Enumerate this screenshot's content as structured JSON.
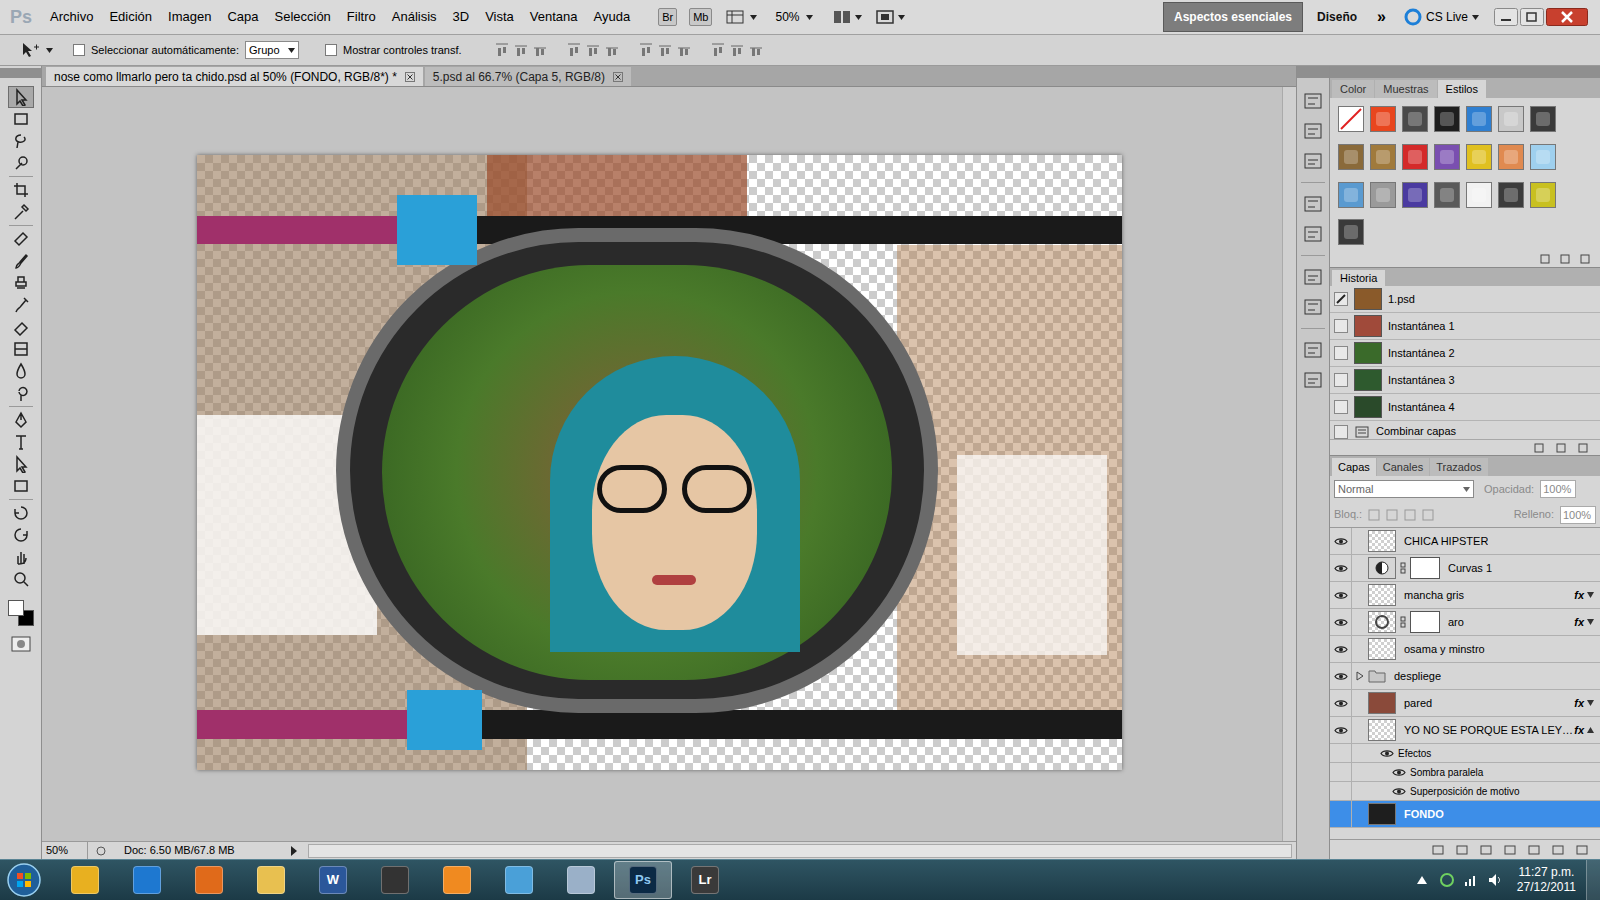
{
  "app": {
    "logo": "Ps",
    "menu": [
      "Archivo",
      "Edición",
      "Imagen",
      "Capa",
      "Selección",
      "Filtro",
      "Análisis",
      "3D",
      "Vista",
      "Ventana",
      "Ayuda"
    ],
    "bridge": "Br",
    "minibridge": "Mb",
    "zoom": "50%",
    "workspaces": [
      {
        "label": "Aspectos esenciales",
        "selected": true
      },
      {
        "label": "Diseño",
        "selected": false
      }
    ],
    "more": "»",
    "cs_live": "CS Live"
  },
  "options_bar": {
    "auto_select": {
      "label": "Seleccionar automáticamente:",
      "checked": false
    },
    "auto_select_target": "Grupo",
    "show_transform": {
      "label": "Mostrar controles transf.",
      "checked": false
    }
  },
  "documents": [
    {
      "label": "nose como llmarlo pero ta chido.psd al 50% (FONDO, RGB/8*) *",
      "selected": true
    },
    {
      "label": "5.psd al 66.7% (Capa 5, RGB/8)",
      "selected": false
    }
  ],
  "tools": {
    "items": [
      {
        "selected": true
      },
      {
        "selected": false
      },
      {
        "selected": false
      },
      {
        "selected": false
      },
      {
        "selected": false
      },
      {
        "selected": false
      },
      {
        "selected": false
      },
      {
        "selected": false
      },
      {
        "selected": false
      },
      {
        "selected": false
      },
      {
        "selected": false
      },
      {
        "selected": false
      },
      {
        "selected": false
      },
      {
        "selected": false
      },
      {
        "selected": false
      },
      {
        "selected": false
      },
      {
        "selected": false
      },
      {
        "selected": false
      },
      {
        "selected": false
      },
      {
        "selected": false
      },
      {
        "selected": false
      },
      {
        "selected": false
      }
    ],
    "foreground": "#ffffff",
    "background": "#000000"
  },
  "status_bar": {
    "zoom": "50%",
    "doc": "Doc: 6.50 MB/67.8 MB"
  },
  "panels": {
    "top_tabs": [
      {
        "label": "Color",
        "selected": false
      },
      {
        "label": "Muestras",
        "selected": false
      },
      {
        "label": "Estilos",
        "selected": true
      }
    ],
    "styles": [
      {
        "color": "#ffffff",
        "kind": "none"
      },
      {
        "color": "#e8461e",
        "kind": "style"
      },
      {
        "color": "#4a4a4a",
        "kind": "style"
      },
      {
        "color": "#1e1e1e",
        "kind": "style"
      },
      {
        "color": "#2f7fd1",
        "kind": "style"
      },
      {
        "color": "#c8c8c8",
        "kind": "style"
      },
      {
        "color": "#3a3a3a",
        "kind": "style"
      },
      {
        "color": "#8a6a3a",
        "kind": "style"
      },
      {
        "color": "#a07a3c",
        "kind": "style"
      },
      {
        "color": "#d42a2a",
        "kind": "style"
      },
      {
        "color": "#7a4fb0",
        "kind": "style"
      },
      {
        "color": "#e0c020",
        "kind": "style"
      },
      {
        "color": "#e08a50",
        "kind": "style"
      },
      {
        "color": "#9fd0ee",
        "kind": "style"
      },
      {
        "color": "#5a9ad0",
        "kind": "style"
      },
      {
        "color": "#9a9a9a",
        "kind": "style"
      },
      {
        "color": "#4a3aa0",
        "kind": "style"
      },
      {
        "color": "#5a5a5a",
        "kind": "style"
      },
      {
        "color": "#f2f2f2",
        "kind": "style"
      },
      {
        "color": "#3c3c3c",
        "kind": "style"
      },
      {
        "color": "#c8c020",
        "kind": "style"
      },
      {
        "color": "#3a3a3a",
        "kind": "style"
      }
    ],
    "history": {
      "title": "Historia",
      "items": [
        {
          "label": "1.psd",
          "source": true,
          "kind": "snapshot",
          "color": "#8a5a2a"
        },
        {
          "label": "Instantánea 1",
          "source": false,
          "kind": "snapshot",
          "color": "#a04a3a"
        },
        {
          "label": "Instantánea 2",
          "source": false,
          "kind": "snapshot",
          "color": "#3a6a2a"
        },
        {
          "label": "Instantánea 3",
          "source": false,
          "kind": "snapshot",
          "color": "#2e5a2e"
        },
        {
          "label": "Instantánea 4",
          "source": false,
          "kind": "snapshot",
          "color": "#2a4a2a"
        },
        {
          "label": "Combinar capas",
          "source": false,
          "kind": "step",
          "color": "#d6d6d6"
        }
      ]
    },
    "layers": {
      "tabs": [
        {
          "label": "Capas",
          "selected": true
        },
        {
          "label": "Canales",
          "selected": false
        },
        {
          "label": "Trazados",
          "selected": false
        }
      ],
      "blend_mode": "Normal",
      "opacity_label": "Opacidad:",
      "opacity": "100%",
      "lock_label": "Bloq.:",
      "fill_label": "Relleno:",
      "fill": "100%",
      "fx_label": "fx",
      "items": [
        {
          "label": "CHICA HIPSTER",
          "kind": "layer",
          "visible": true,
          "has_fx": false,
          "mask": false,
          "thumb": "checker",
          "selected": false
        },
        {
          "label": "Curvas 1",
          "kind": "adjustment",
          "visible": true,
          "has_fx": false,
          "mask": true,
          "thumb": "adjust",
          "selected": false
        },
        {
          "label": "mancha gris",
          "kind": "layer",
          "visible": true,
          "has_fx": true,
          "mask": false,
          "thumb": "checker",
          "selected": false
        },
        {
          "label": "aro",
          "kind": "layer",
          "visible": true,
          "has_fx": true,
          "mask": true,
          "thumb": "ring",
          "selected": false
        },
        {
          "label": "osama y minstro",
          "kind": "layer",
          "visible": true,
          "has_fx": false,
          "mask": false,
          "thumb": "checker",
          "selected": false
        },
        {
          "label": "despliege",
          "kind": "group",
          "visible": true,
          "has_fx": false,
          "mask": false,
          "thumb": "folder",
          "selected": false,
          "expanded": false
        },
        {
          "label": "pared",
          "kind": "layer",
          "visible": true,
          "has_fx": true,
          "mask": false,
          "thumb": "photo",
          "selected": false
        },
        {
          "label": "YO NO SE PORQUE ESTA LEY…",
          "kind": "layer",
          "visible": true,
          "has_fx": true,
          "mask": false,
          "thumb": "checker",
          "selected": false,
          "expanded": true
        },
        {
          "label": "Efectos",
          "kind": "effects",
          "visible": true,
          "selected": false
        },
        {
          "label": "Sombra paralela",
          "kind": "effect",
          "visible": true,
          "selected": false
        },
        {
          "label": "Superposición de motivo",
          "kind": "effect",
          "visible": true,
          "selected": false
        },
        {
          "label": "FONDO",
          "kind": "layer",
          "visible": false,
          "has_fx": false,
          "mask": false,
          "thumb": "dark",
          "selected": true
        }
      ]
    }
  },
  "taskbar": {
    "apps": [
      {
        "color": "#e8b020",
        "active": false
      },
      {
        "color": "#1e78d0",
        "active": false
      },
      {
        "color": "#e06a1a",
        "active": false
      },
      {
        "color": "#e8c050",
        "active": false
      },
      {
        "label": "W",
        "color": "#2b579a",
        "active": false
      },
      {
        "color": "#333333",
        "active": false
      },
      {
        "color": "#f08a20",
        "active": false
      },
      {
        "color": "#4aa0d8",
        "active": false
      },
      {
        "color": "#9ab0c8",
        "active": false
      },
      {
        "label": "Ps",
        "color": "#0b2a45",
        "active": true
      },
      {
        "label": "Lr",
        "color": "#3a3a3a",
        "active": false
      }
    ],
    "time": "11:27 p.m.",
    "date": "27/12/2011"
  }
}
